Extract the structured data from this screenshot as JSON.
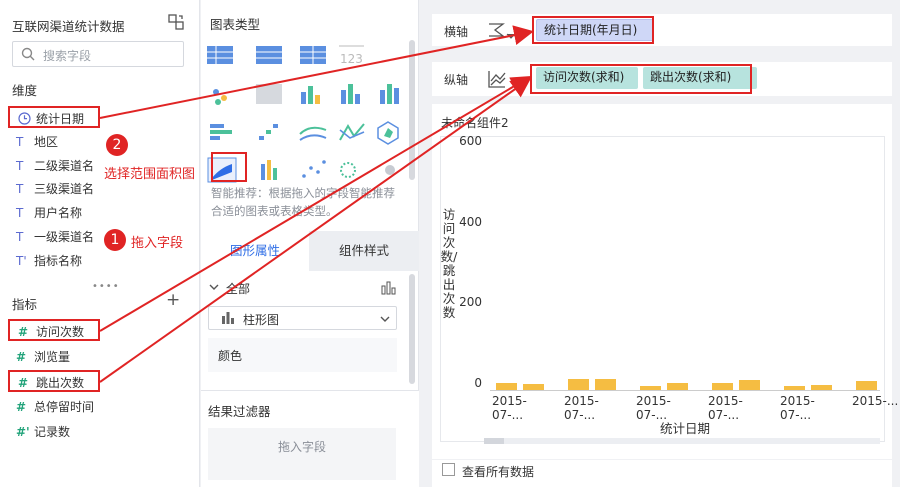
{
  "left_panel": {
    "dataset_title": "互联网渠道统计数据",
    "search_placeholder": "搜索字段",
    "dimensions_title": "维度",
    "dimensions": [
      {
        "type": "date",
        "label": "统计日期"
      },
      {
        "type": "text",
        "label": "地区"
      },
      {
        "type": "text",
        "label": "二级渠道名"
      },
      {
        "type": "text",
        "label": "三级渠道名"
      },
      {
        "type": "text",
        "label": "用户名称"
      },
      {
        "type": "text",
        "label": "一级渠道名"
      },
      {
        "type": "text-derived",
        "label": "指标名称"
      }
    ],
    "measures_title": "指标",
    "measures": [
      {
        "label": "访问次数"
      },
      {
        "label": "浏览量"
      },
      {
        "label": "跳出次数"
      },
      {
        "label": "总停留时间"
      },
      {
        "label": "记录数",
        "derived": true
      }
    ]
  },
  "middle_panel": {
    "chart_type_title": "图表类型",
    "smart_tip": "智能推荐：根据拖入的字段智能推荐合适的图表或表格类型。",
    "tabs": [
      "图形属性",
      "组件样式"
    ],
    "attr_all": "全部",
    "chart_select": "柱形图",
    "color_label": "颜色",
    "filter_title": "结果过滤器",
    "filter_drop": "拖入字段"
  },
  "right_panel": {
    "x_axis_label": "横轴",
    "y_axis_label": "纵轴",
    "x_pill": "统计日期(年月日)",
    "y_pills": [
      "访问次数(求和)",
      "跳出次数(求和)"
    ],
    "chart_title": "未命名组件2",
    "show_all_data": "查看所有数据"
  },
  "annotations": {
    "step1_number": "1",
    "step1_text": "拖入字段",
    "step2_number": "2",
    "step2_text": "选择范围面积图"
  },
  "colors": {
    "accent": "#2f6ee6",
    "highlight": "#e02424",
    "bar": "#f5bd42",
    "dimension_icon": "#5b6ad0",
    "measure_icon": "#22a37a"
  },
  "chart_data": {
    "type": "bar",
    "ylabel": "访问次数/跳出次数",
    "xlabel": "统计日期",
    "yticks": [
      0,
      200,
      400,
      600
    ],
    "ylim": [
      0,
      600
    ],
    "categories": [
      "2015-07-...",
      "2015-07-...",
      "2015-07-...",
      "2015-07-...",
      "2015-07-...",
      "2015-..."
    ],
    "series": [
      {
        "values": [
          18,
          28,
          10,
          17,
          10,
          22
        ]
      },
      {
        "values": [
          15,
          28,
          17,
          25,
          12,
          0
        ]
      }
    ]
  }
}
